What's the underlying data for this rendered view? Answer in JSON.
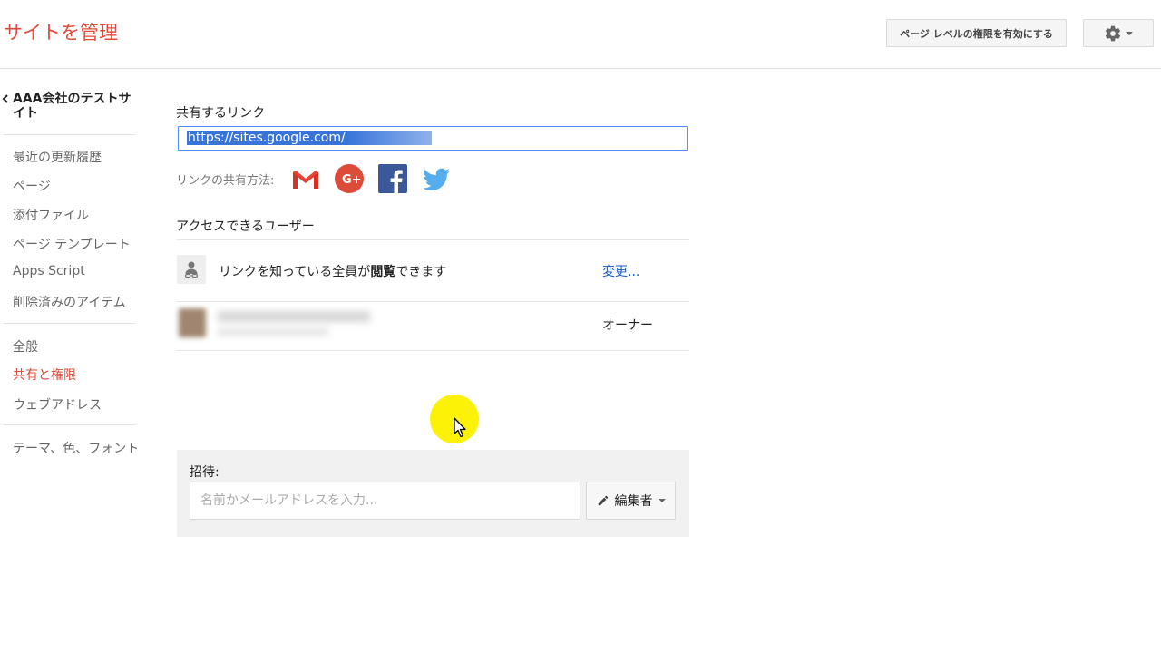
{
  "header": {
    "title": "サイトを管理",
    "page_permission_button": "ページ レベルの権限を有効にする",
    "settings_icon": "gear-icon"
  },
  "sidebar": {
    "back_label": "AAA会社のテストサイト",
    "items": [
      {
        "label": "最近の更新履歴"
      },
      {
        "label": "ページ"
      },
      {
        "label": "添付ファイル"
      },
      {
        "label": "ページ テンプレート"
      },
      {
        "label": "Apps Script"
      },
      {
        "label": "削除済みのアイテム"
      },
      {
        "label": "全般"
      },
      {
        "label": "共有と権限",
        "active": true
      },
      {
        "label": "ウェブアドレス"
      },
      {
        "label": "テーマ、色、フォント"
      }
    ]
  },
  "share": {
    "link_label": "共有するリンク",
    "link_value": "https://sites.google.com/",
    "share_via_label": "リンクの共有方法:",
    "social": [
      "gmail-icon",
      "google-plus-icon",
      "facebook-icon",
      "twitter-icon"
    ]
  },
  "access": {
    "heading": "アクセスできるユーザー",
    "link_access_text_before": "リンクを知っている全員が",
    "link_access_text_bold": "閲覧",
    "link_access_text_after": "できます",
    "change_link": "変更...",
    "owner_role": "オーナー"
  },
  "invite": {
    "label": "招待:",
    "placeholder": "名前かメールアドレスを入力...",
    "role": "編集者"
  },
  "colors": {
    "brand_red": "#dd4b39",
    "link_blue": "#1155cc",
    "focus_blue": "#4d90fe",
    "cursor_halo": "#fbf207"
  }
}
